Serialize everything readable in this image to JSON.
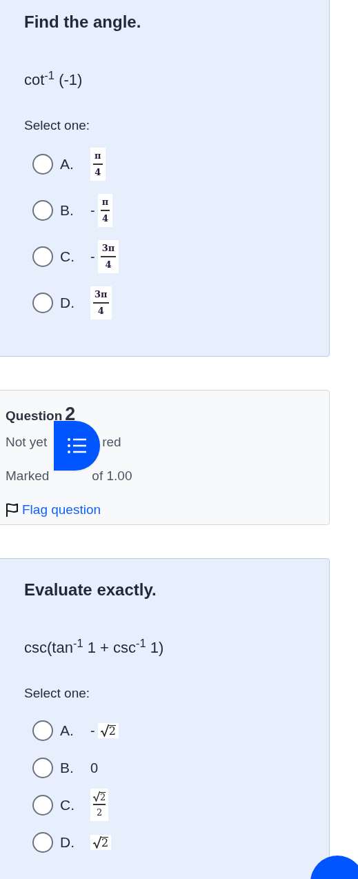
{
  "questions": [
    {
      "prompt": "Find the angle.",
      "expression": "cot$^{-1}$ (-1)",
      "instruction": "Select one:",
      "options": [
        {
          "letter": "A.",
          "selected": false,
          "answer": {
            "kind": "fraction",
            "numerator": "π",
            "denominator": "4"
          }
        },
        {
          "letter": "B.",
          "selected": false,
          "answer": {
            "kind": "fraction",
            "sign": "-",
            "numerator": "π",
            "denominator": "4"
          }
        },
        {
          "letter": "C.",
          "selected": false,
          "answer": {
            "kind": "fraction",
            "sign": "-",
            "numerator": "3π",
            "denominator": "4"
          }
        },
        {
          "letter": "D.",
          "selected": false,
          "answer": {
            "kind": "fraction",
            "numerator": "3π",
            "denominator": "4"
          }
        }
      ]
    },
    {
      "info": {
        "label": "Question",
        "number": "2",
        "status_parts": [
          "Not yet",
          "red"
        ],
        "marks_parts": [
          "Marked",
          "of 1.00"
        ],
        "flag": "Flag question"
      },
      "prompt": "Evaluate exactly.",
      "expression": "csc(tan$^{-1}$ 1 + csc$^{-1}$ 1)",
      "instruction": "Select one:",
      "options": [
        {
          "letter": "A.",
          "selected": false,
          "answer": {
            "kind": "root",
            "sign": "-",
            "radicand": "2"
          }
        },
        {
          "letter": "B.",
          "selected": false,
          "answer": {
            "kind": "text",
            "text": "0"
          }
        },
        {
          "letter": "C.",
          "selected": false,
          "answer": {
            "kind": "root_fraction",
            "radicand": "2",
            "denominator": "2"
          }
        },
        {
          "letter": "D.",
          "selected": false,
          "answer": {
            "kind": "root",
            "radicand": "2"
          }
        }
      ]
    }
  ]
}
